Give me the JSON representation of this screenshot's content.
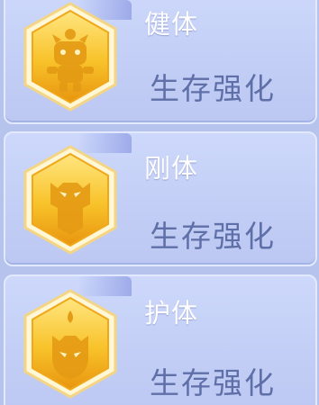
{
  "talents": [
    {
      "name": "健体",
      "category": "生存强化",
      "icon": "robot-cat-icon"
    },
    {
      "name": "刚体",
      "category": "生存强化",
      "icon": "cat-shield-icon"
    },
    {
      "name": "护体",
      "category": "生存强化",
      "icon": "cat-flame-icon"
    }
  ],
  "colors": {
    "card_bg": "#c3cef6",
    "badge_gold": "#f5b91e",
    "badge_light": "#ffe27a",
    "title_text": "#ffffff",
    "subtitle_text": "#5f6fa8"
  }
}
